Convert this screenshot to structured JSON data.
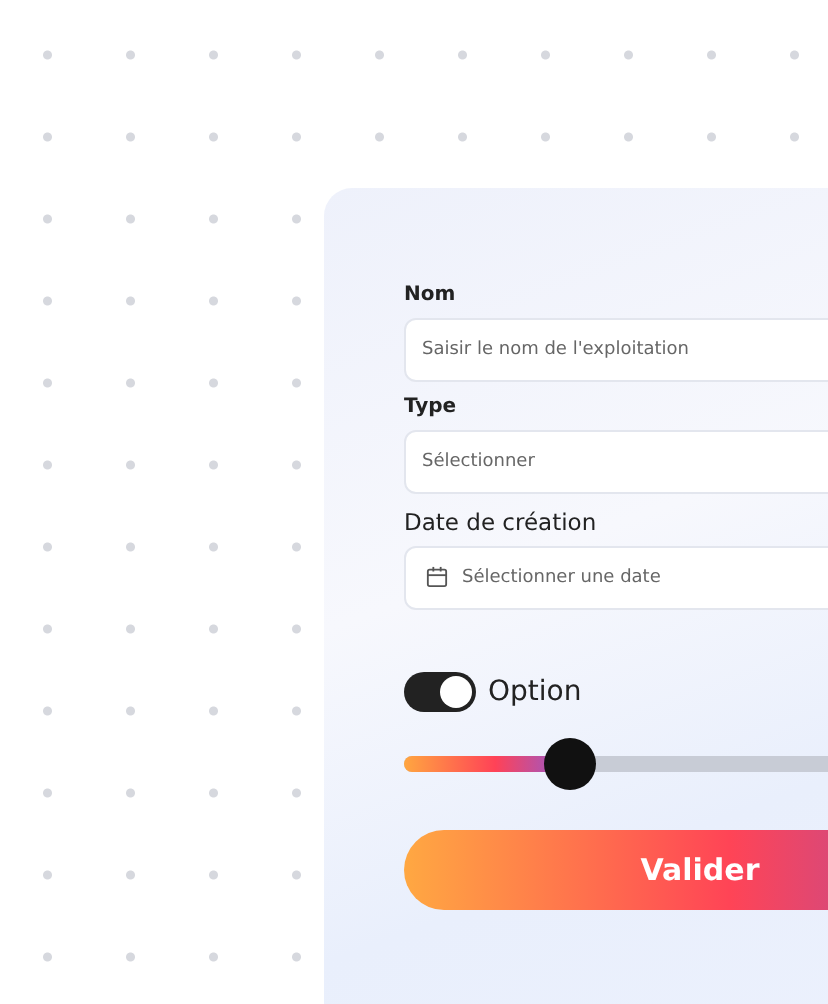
{
  "form": {
    "fields": [
      {
        "kind": "text",
        "label": "Nom",
        "placeholder": "Saisir le nom de l'exploitation"
      },
      {
        "kind": "select",
        "label": "Type",
        "placeholder": "Sélectionner"
      },
      {
        "kind": "date",
        "label": "Date de création",
        "placeholder": "Sélectionner une date"
      }
    ],
    "toggle": {
      "label": "Option",
      "on": true
    },
    "slider": {
      "level": 0.32
    },
    "submit": {
      "label": "Valider"
    }
  }
}
